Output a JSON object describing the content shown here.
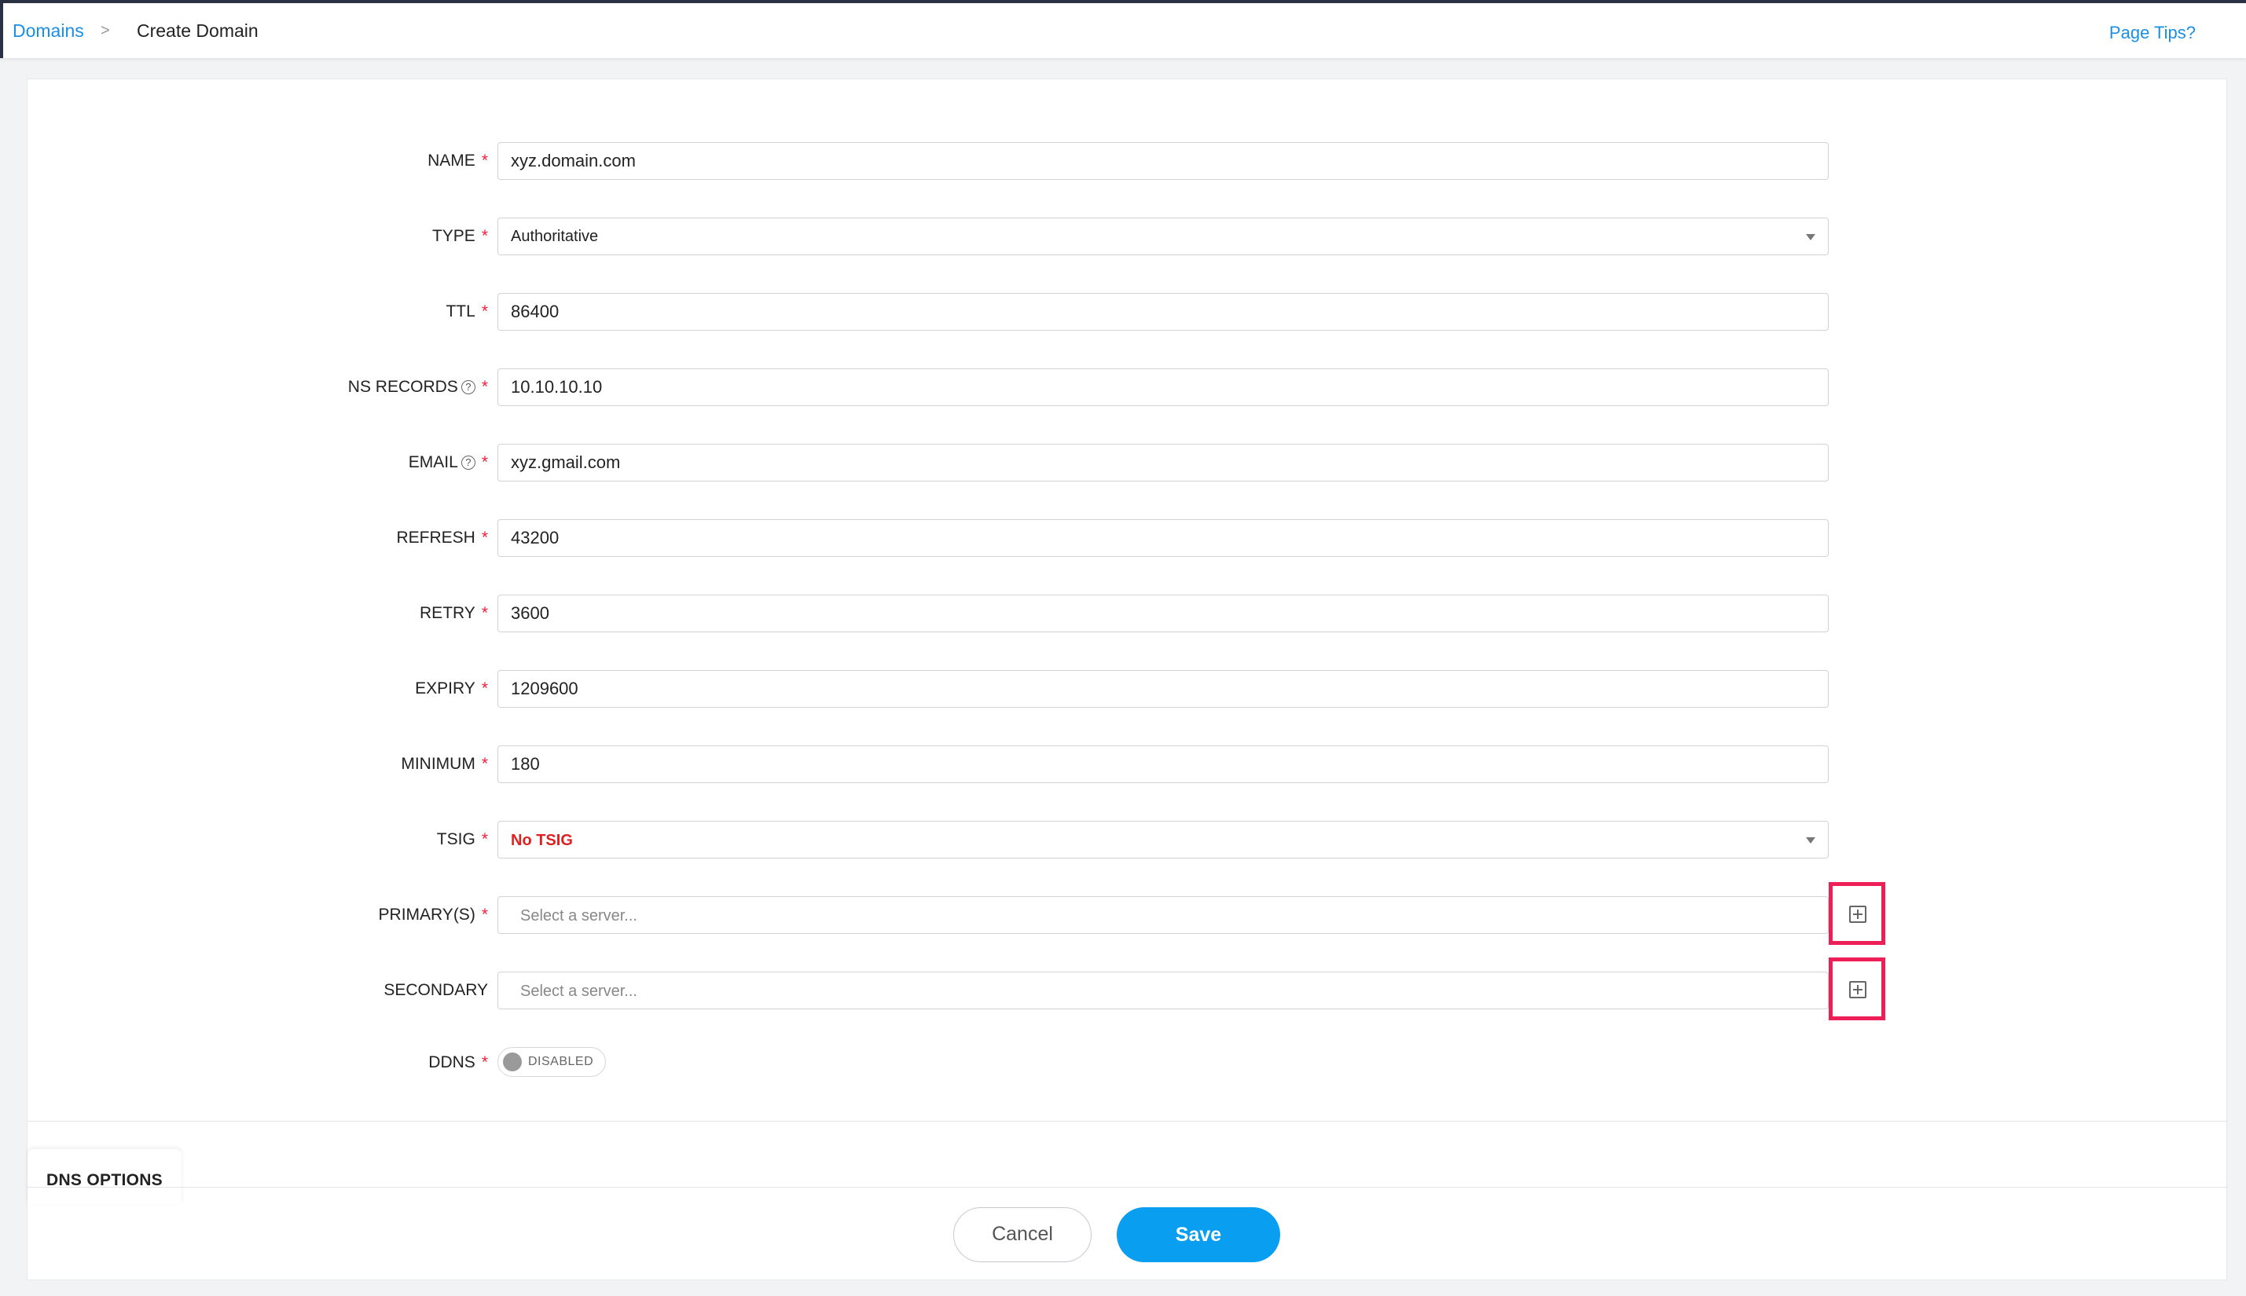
{
  "breadcrumb": {
    "parent": "Domains",
    "separator": ">",
    "current": "Create Domain"
  },
  "page_tips": "Page Tips?",
  "form": {
    "name": {
      "label": "NAME",
      "value": "xyz.domain.com"
    },
    "type": {
      "label": "TYPE",
      "value": "Authoritative"
    },
    "ttl": {
      "label": "TTL",
      "value": "86400"
    },
    "ns_records": {
      "label": "NS RECORDS",
      "value": "10.10.10.10"
    },
    "email": {
      "label": "EMAIL",
      "value": "xyz.gmail.com"
    },
    "refresh": {
      "label": "REFRESH",
      "value": "43200"
    },
    "retry": {
      "label": "RETRY",
      "value": "3600"
    },
    "expiry": {
      "label": "EXPIRY",
      "value": "1209600"
    },
    "minimum": {
      "label": "MINIMUM",
      "value": "180"
    },
    "tsig": {
      "label": "TSIG",
      "value": "No TSIG"
    },
    "primaries": {
      "label": "PRIMARY(S)",
      "placeholder": "Select a server..."
    },
    "secondary": {
      "label": "SECONDARY",
      "placeholder": "Select a server..."
    },
    "ddns": {
      "label": "DDNS",
      "state": "DISABLED"
    },
    "required_mark": "*",
    "help_glyph": "?"
  },
  "dns_options_tab": "DNS OPTIONS",
  "actions": {
    "cancel": "Cancel",
    "save": "Save"
  },
  "colors": {
    "accent": "#0a9ef0",
    "required": "#e8203a",
    "highlight": "#ee1e56",
    "tsig_text": "#e02020"
  }
}
